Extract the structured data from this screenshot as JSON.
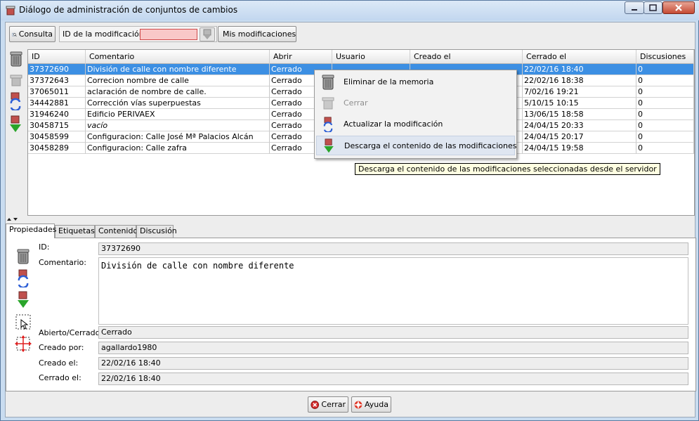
{
  "window": {
    "title": "Diálogo de administración de conjuntos de cambios"
  },
  "toolbar": {
    "consulta_label": "Consulta",
    "id_label": "ID de la modificación:",
    "id_value": "",
    "mis_label": "Mis modificaciones"
  },
  "table": {
    "columns": [
      "ID",
      "Comentario",
      "Abrir",
      "Usuario",
      "Creado el",
      "Cerrado el",
      "Discusiones"
    ],
    "rows": [
      [
        "37372690",
        "División de calle con nombre diferente",
        "Cerrado",
        "",
        "",
        "22/02/16 18:40",
        "0"
      ],
      [
        "37372643",
        "Correcion nombre de calle",
        "Cerrado",
        "",
        "",
        "22/02/16 18:38",
        "0"
      ],
      [
        "37065011",
        "aclaración de nombre de calle.",
        "Cerrado",
        "",
        "",
        "7/02/16 19:21",
        "0"
      ],
      [
        "34442881",
        "Corrección vías superpuestas",
        "Cerrado",
        "",
        "",
        "5/10/15 10:15",
        "0"
      ],
      [
        "31946240",
        "Edificio PERIVAEX",
        "Cerrado",
        "",
        "",
        "13/06/15 18:58",
        "0"
      ],
      [
        "30458715",
        "vacío",
        "Cerrado",
        "",
        "",
        "24/04/15 20:33",
        "0"
      ],
      [
        "30458599",
        "Configuracion: Calle José Mª Palacios Alcán",
        "Cerrado",
        "",
        "",
        "24/04/15 20:17",
        "0"
      ],
      [
        "30458289",
        "Configuracion: Calle zafra",
        "Cerrado",
        "",
        "",
        "24/04/15 19:58",
        "0"
      ]
    ]
  },
  "context_menu": {
    "items": [
      {
        "label": "Eliminar de la memoria",
        "enabled": true
      },
      {
        "label": "Cerrar",
        "enabled": false
      },
      {
        "label": "Actualizar la modificación",
        "enabled": true
      },
      {
        "label": "Descarga el contenido de las modificaciones",
        "enabled": true
      }
    ],
    "tooltip": "Descarga el contenido de las modificaciones seleccionadas desde el servidor"
  },
  "tabs": [
    "Propiedades",
    "Etiquetas",
    "Contenido",
    "Discusión"
  ],
  "properties": {
    "id_label": "ID:",
    "id_value": "37372690",
    "comment_label": "Comentario:",
    "comment_value": "División de calle con nombre diferente",
    "state_label": "Abierto/Cerrado:",
    "state_value": "Cerrado",
    "created_by_label": "Creado por:",
    "created_by_value": "agallardo1980",
    "created_label": "Creado el:",
    "created_value": "22/02/16 18:40",
    "closed_label": "Cerrado el:",
    "closed_value": "22/02/16 18:40"
  },
  "footer": {
    "cerrar_label": "Cerrar",
    "ayuda_label": "Ayuda"
  },
  "icons": [
    "window-icon",
    "minimize-icon",
    "maximize-icon",
    "close-icon",
    "search-icon",
    "download-icon",
    "trash-icon",
    "close-changeset-icon",
    "refresh-icon",
    "select-icon",
    "move-icon",
    "cancel-icon",
    "help-icon"
  ],
  "colors": {
    "selection": "#3c8fe3",
    "tooltip_bg": "#ffffe1",
    "invalid_input": "#f9c8c8"
  }
}
